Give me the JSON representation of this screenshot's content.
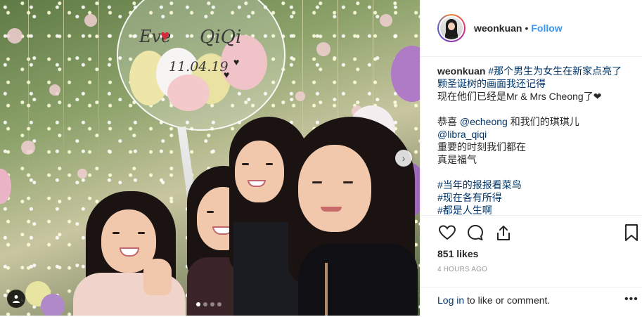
{
  "photo": {
    "balloon_name_left": "Eve",
    "balloon_name_right": "QiQi",
    "balloon_date": "11.04.19",
    "carousel_dots": 4,
    "carousel_active": 1,
    "icons": {
      "next": "chevron-right-icon",
      "tag": "user-tag-icon"
    }
  },
  "header": {
    "username": "weonkuan",
    "separator": "•",
    "follow_label": "Follow"
  },
  "caption": {
    "lines": [
      {
        "user": "weonkuan",
        "text": " #那个男生为女生在新家点亮了"
      },
      {
        "text": "颗圣诞树的画面我还记得"
      },
      {
        "text": "现在他们已经是Mr & Mrs Cheong了❤"
      },
      {
        "text": ""
      },
      {
        "text": "恭喜 ",
        "mention": "@echeong",
        "after": " 和我们的琪琪儿"
      },
      {
        "mention": "@libra_qiqi"
      },
      {
        "text": "重要的时刻我们都在"
      },
      {
        "text": "真是福气"
      },
      {
        "text": ""
      },
      {
        "hashtag": "#当年的报报看菜鸟"
      },
      {
        "hashtag": "#现在各有所得"
      },
      {
        "hashtag": "#都是人生啊"
      }
    ]
  },
  "actions": {
    "icons": [
      "heart-icon",
      "comment-icon",
      "share-icon",
      "bookmark-icon"
    ]
  },
  "likes": "851 likes",
  "timestamp": "4 HOURS AGO",
  "comment": {
    "login_link": "Log in",
    "login_rest": " to like or comment.",
    "more": "•••"
  },
  "colors": {
    "link": "#3897f0",
    "text": "#262626",
    "muted": "#999999",
    "border": "#efefef",
    "hashtag": "#003569"
  }
}
